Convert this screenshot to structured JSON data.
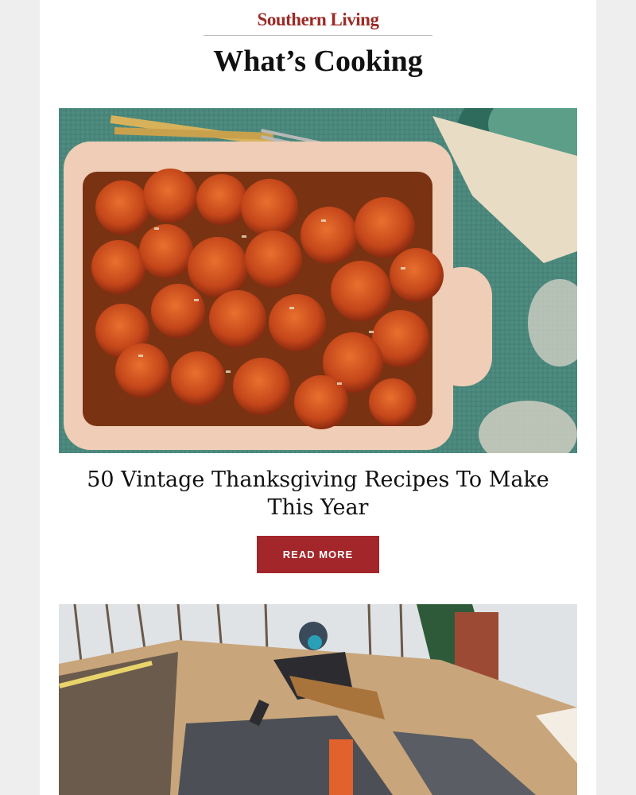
{
  "header": {
    "brand": "Southern Living",
    "section_title": "What’s Cooking"
  },
  "articles": [
    {
      "image": "roasted-sweet-potatoes-photo",
      "headline": "50 Vintage Thanksgiving Recipes To Make This Year",
      "cta_label": "READ MORE"
    },
    {
      "image": "roofer-installing-shingles-photo"
    }
  ],
  "colors": {
    "brand": "#9b2a26",
    "cta_background": "#a3262a",
    "page_background": "#eeeeee",
    "card_background": "#ffffff"
  }
}
